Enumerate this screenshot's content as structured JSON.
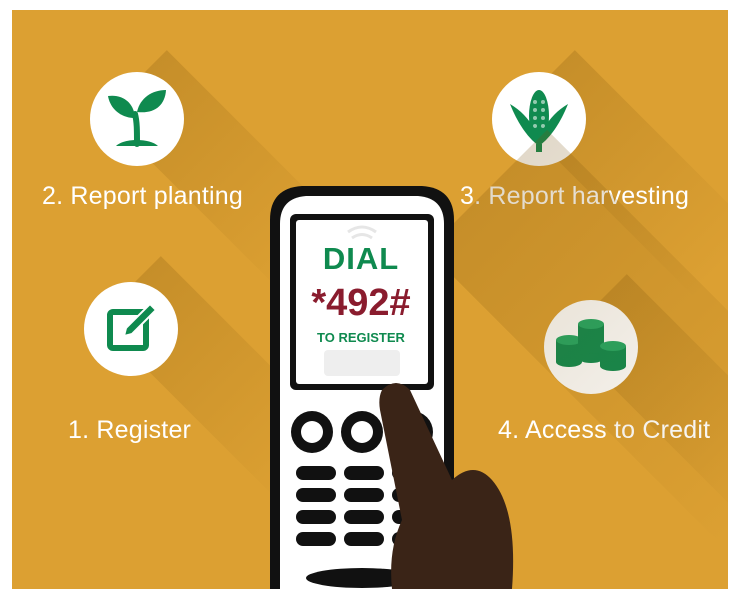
{
  "steps": [
    {
      "label": "2. Report planting",
      "icon": "sprout-icon"
    },
    {
      "label": "3. Report harvesting",
      "icon": "corn-icon"
    },
    {
      "label": "1. Register",
      "icon": "edit-form-icon"
    },
    {
      "label": "4. Access to Credit",
      "icon": "coin-stacks-icon"
    }
  ],
  "phone": {
    "dial": "DIAL",
    "code": "*492#",
    "register": "TO REGISTER"
  },
  "colors": {
    "background": "#dca032",
    "icon_green": "#0f8a4f",
    "code_red": "#8a1c2e",
    "hand": "#3a2417"
  }
}
